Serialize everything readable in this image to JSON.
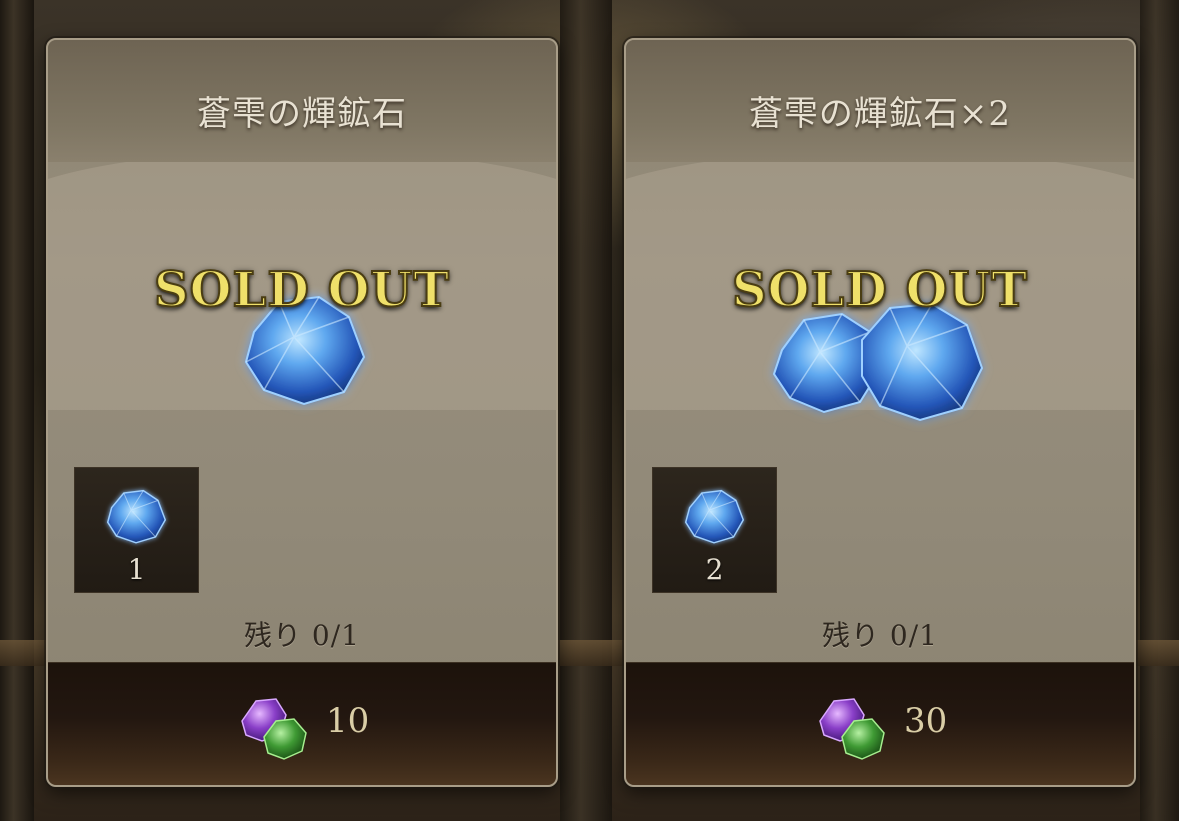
{
  "cards": [
    {
      "title": "蒼雫の輝鉱石",
      "status": "SOLD OUT",
      "item_icon": "blue-ore-icon",
      "item_quantity": "1",
      "remaining": "残り 0/1",
      "currency_icon": "purple-green-gem-icon",
      "price": "10"
    },
    {
      "title": "蒼雫の輝鉱石×2",
      "status": "SOLD OUT",
      "item_icon": "blue-ore-icon",
      "item_quantity": "2",
      "remaining": "残り 0/1",
      "currency_icon": "purple-green-gem-icon",
      "price": "30"
    }
  ],
  "colors": {
    "sold_out_text": "#efe06a",
    "ore_blue": "#2f6fd0",
    "currency_purple": "#8a3fc8",
    "currency_green": "#3f9a34"
  }
}
